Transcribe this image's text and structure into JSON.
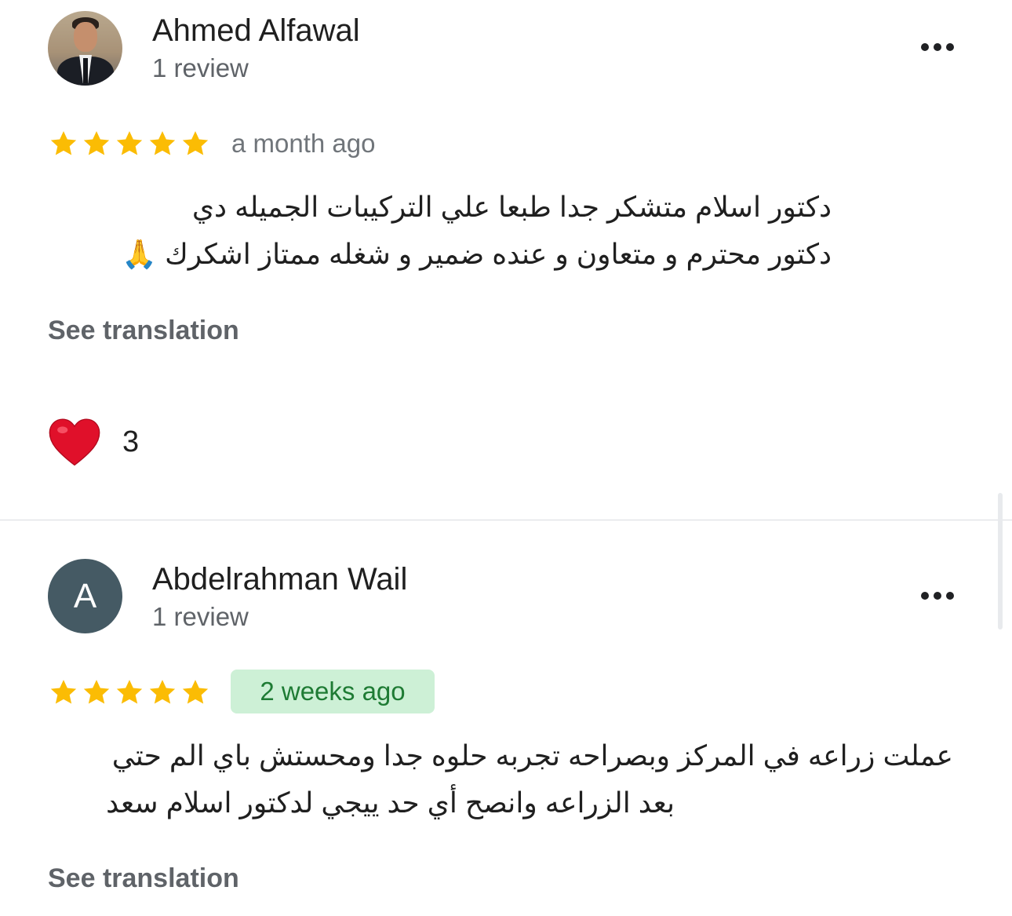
{
  "reviews": [
    {
      "author": "Ahmed Alfawal",
      "meta": "1 review",
      "avatar": "photo",
      "rating": 5,
      "time": "a month ago",
      "text_lines": [
        "دكتور اسلام متشكر جدا طبعا علي التركيبات الجميله دي",
        "دكتور محترم و متعاون و عنده ضمير و شغله ممتاز اشكرك 🙏"
      ],
      "see_translation": "See translation",
      "reaction_icon": "red-heart-icon",
      "reaction_count": "3"
    },
    {
      "author": "Abdelrahman Wail",
      "meta": "1 review",
      "avatar_letter": "A",
      "avatar_color": "#455a64",
      "rating": 5,
      "time": "2 weeks ago",
      "text_lines": [
        "عملت زراعه في المركز وبصراحه تجربه حلوه جدا ومحستش باي الم حتي",
        "بعد الزراعه وانصح أي حد ييجي لدكتور اسلام سعد"
      ],
      "see_translation": "See translation"
    }
  ],
  "colors": {
    "star": "#fbbc04",
    "time_highlight_bg": "#cdf0d6",
    "time_highlight_text": "#1e7b34",
    "heart": "#e0102a"
  }
}
